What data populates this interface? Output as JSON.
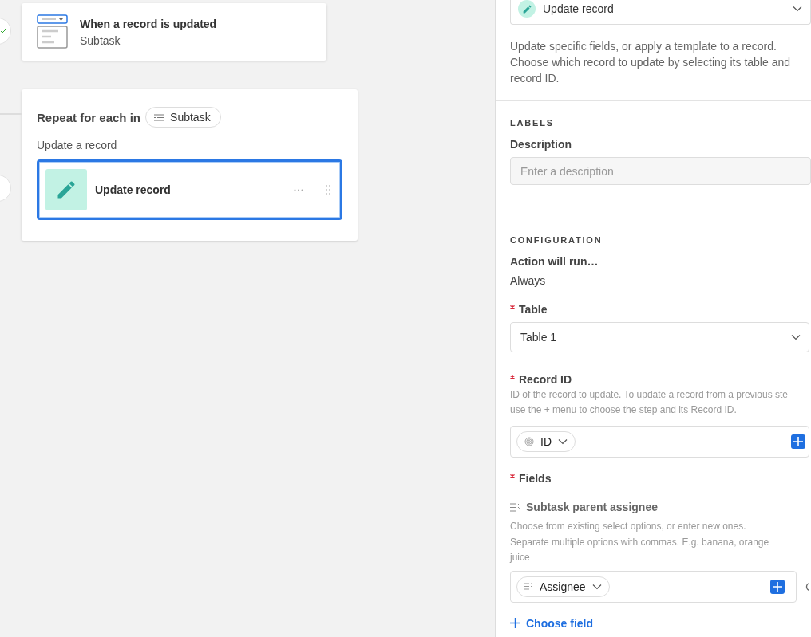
{
  "trigger": {
    "title": "When a record is updated",
    "subtitle": "Subtask"
  },
  "loop": {
    "title": "Repeat for each in",
    "source": "Subtask",
    "label": "Update a record",
    "step": {
      "title": "Update record",
      "selected": true
    }
  },
  "panel": {
    "action": "Update record",
    "description": "Update specific fields, or apply a template to a record. Choose which record to update by selecting its table and record ID.",
    "labels": {
      "heading": "LABELS",
      "field_label": "Description",
      "placeholder": "Enter a description"
    },
    "configuration": {
      "heading": "CONFIGURATION",
      "run_label": "Action will run…",
      "run_value": "Always",
      "table": {
        "label": "Table",
        "required": true,
        "value": "Table 1"
      },
      "record_id": {
        "label": "Record ID",
        "required": true,
        "help": "ID of the record to update. To update a record from a previous ste",
        "help_2": "use the + menu to choose the step and its Record ID.",
        "token": "ID"
      },
      "fields": {
        "label": "Fields",
        "required": true,
        "items": [
          {
            "name": "Subtask parent assignee",
            "help": "Choose from existing select options, or enter new ones. Separate multiple options with commas. E.g. banana, orange juice",
            "token": "Assignee"
          }
        ],
        "add_link": "Choose field"
      }
    }
  }
}
